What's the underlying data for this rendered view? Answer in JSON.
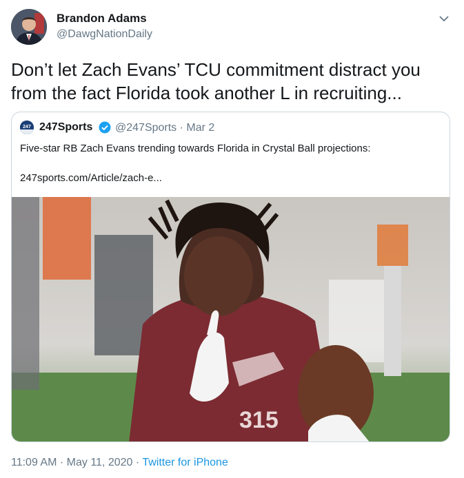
{
  "author": {
    "name": "Brandon Adams",
    "handle": "@DawgNationDaily"
  },
  "tweet": {
    "text": "Don’t let Zach Evans’ TCU commitment distract you from the fact Florida took another L in recruiting..."
  },
  "quoted": {
    "name": "247Sports",
    "handle": "@247Sports",
    "separator": "·",
    "date": "Mar 2",
    "text": "Five-star RB Zach Evans trending towards Florida in Crystal Ball projections:",
    "link": "247sports.com/Article/zach-e...",
    "jersey_number": "315",
    "logo_text": "247"
  },
  "footer": {
    "time": "11:09 AM",
    "separator1": " · ",
    "date": "May 11, 2020",
    "separator2": " · ",
    "source": "Twitter for iPhone"
  },
  "icons": {
    "caret": "chevron-down-icon",
    "verified": "verified-badge-icon"
  },
  "colors": {
    "link_blue": "#1b95e0",
    "secondary_text": "#657786",
    "border": "#ccd6dd",
    "jersey_maroon": "#7c2b32"
  }
}
